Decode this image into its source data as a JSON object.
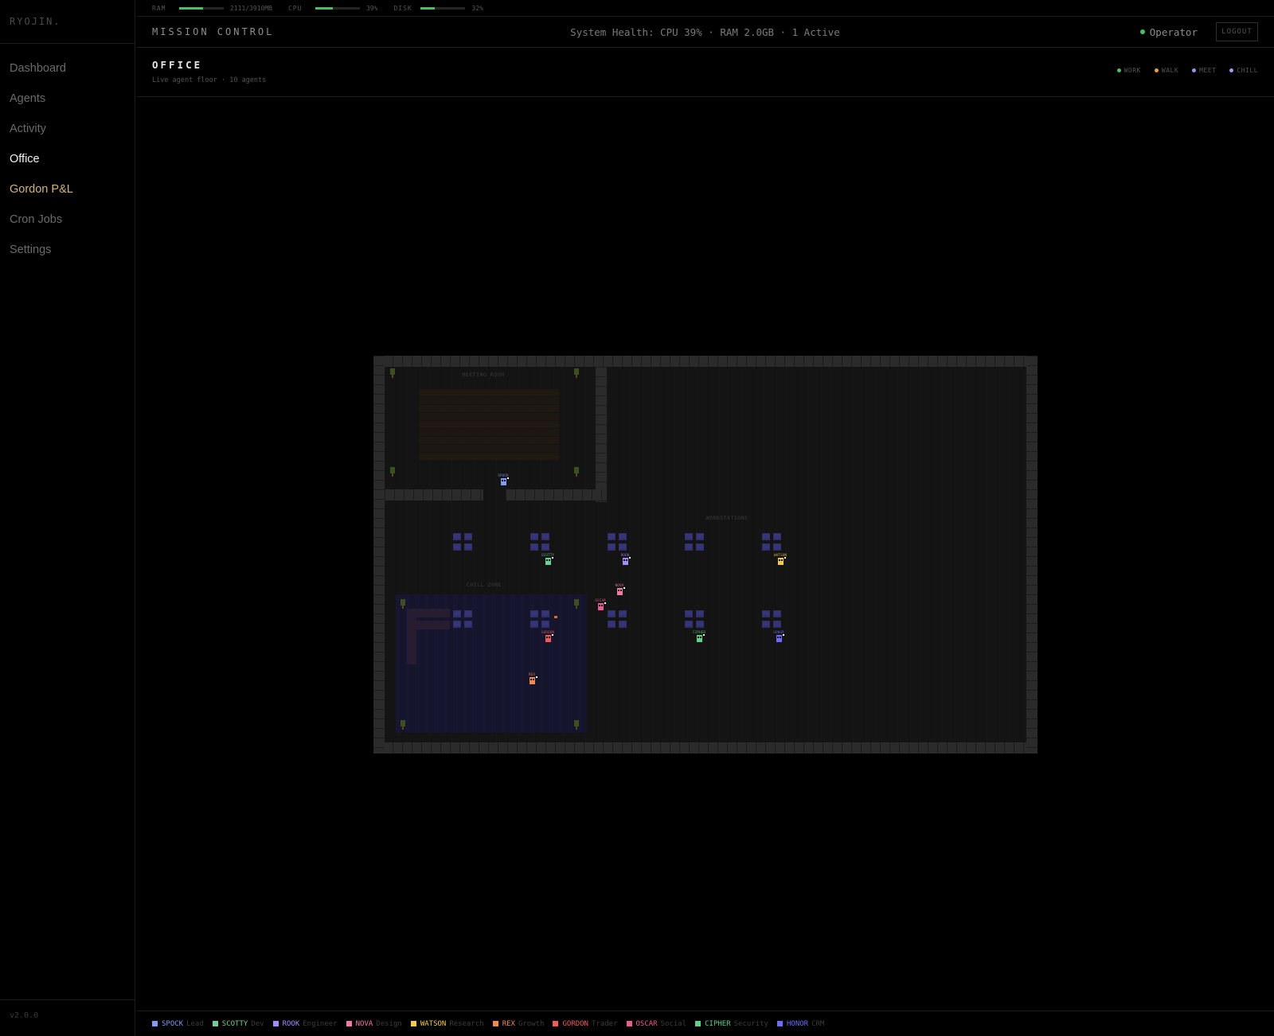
{
  "sidebar": {
    "brand": "RYOJIN.",
    "items": [
      {
        "label": "Dashboard",
        "state": "normal"
      },
      {
        "label": "Agents",
        "state": "normal"
      },
      {
        "label": "Activity",
        "state": "normal"
      },
      {
        "label": "Office",
        "state": "active"
      },
      {
        "label": "Gordon P&L",
        "state": "accent"
      },
      {
        "label": "Cron Jobs",
        "state": "normal"
      },
      {
        "label": "Settings",
        "state": "normal"
      }
    ],
    "version": "v2.0.0"
  },
  "resources": {
    "ram": {
      "label": "RAM",
      "value": "2111/3910MB",
      "fraction": 0.54
    },
    "cpu": {
      "label": "CPU",
      "value": "39%",
      "fraction": 0.39
    },
    "disk": {
      "label": "DISK",
      "value": "32%",
      "fraction": 0.32
    }
  },
  "header": {
    "title": "MISSION CONTROL",
    "health": "System Health: CPU 39% · RAM 2.0GB · 1 Active",
    "operator": "Operator",
    "logout": "LOGOUT"
  },
  "office": {
    "title": "OFFICE",
    "subtitle": "Live agent floor · 10 agents",
    "legend": [
      {
        "label": "WORK",
        "color": "#4bbf63"
      },
      {
        "label": "WALK",
        "color": "#e8a04a"
      },
      {
        "label": "MEET",
        "color": "#8b9cf0"
      },
      {
        "label": "CHILL",
        "color": "#a89cf0"
      }
    ],
    "zones": {
      "meeting": "MEETING ROOM",
      "workstations": "WORKSTATIONS",
      "chill": "CHILL ZONE"
    }
  },
  "agents": [
    {
      "name": "SPOCK",
      "role": "Lead",
      "color": "#7f9cf5"
    },
    {
      "name": "SCOTTY",
      "role": "Dev",
      "color": "#6fcf97"
    },
    {
      "name": "ROOK",
      "role": "Engineer",
      "color": "#a78bfa"
    },
    {
      "name": "NOVA",
      "role": "Design",
      "color": "#f07aa6"
    },
    {
      "name": "WATSON",
      "role": "Research",
      "color": "#f2c94c"
    },
    {
      "name": "REX",
      "role": "Growth",
      "color": "#f0894a"
    },
    {
      "name": "GORDON",
      "role": "Trader",
      "color": "#ef5b5b"
    },
    {
      "name": "OSCAR",
      "role": "Social",
      "color": "#e85d8f"
    },
    {
      "name": "CIPHER",
      "role": "Security",
      "color": "#5fcf8a"
    },
    {
      "name": "HONOR",
      "role": "CRM",
      "color": "#6e6cf5"
    }
  ]
}
